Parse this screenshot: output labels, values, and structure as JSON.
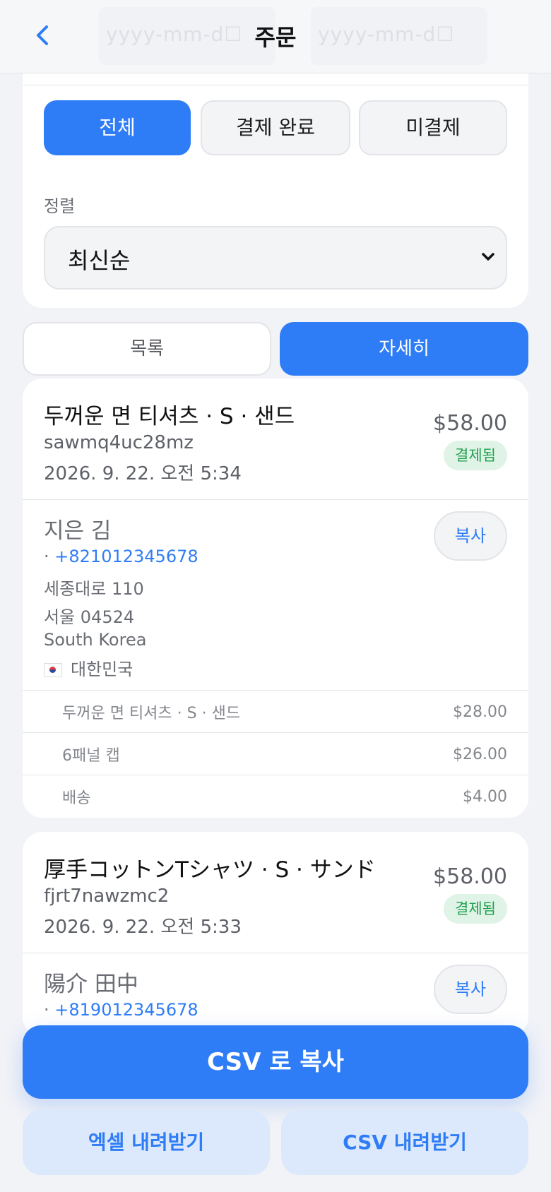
{
  "header": {
    "title": "주문",
    "back_icon": "chevron-left-icon",
    "date_placeholder_from": "yyyy-mm-d☐",
    "date_placeholder_to": "yyyy-mm-d☐"
  },
  "filters": {
    "segments": [
      "전체",
      "결제 완료",
      "미결제"
    ],
    "active_segment": "전체",
    "sort_label": "정렬",
    "sort_value": "최신순"
  },
  "view_toggle": {
    "list": "목록",
    "detail": "자세히",
    "active": "자세히"
  },
  "orders": [
    {
      "title": "두꺼운 면 티셔츠 · S · 샌드",
      "id": "sawmq4uc28mz",
      "date": "2026. 9. 22. 오전 5:34",
      "price": "$58.00",
      "status": "결제됨",
      "customer": {
        "name": "지은 김",
        "phone_prefix": "·",
        "phone": "+821012345678",
        "address1": "세종대로 110",
        "address2": "서울 04524",
        "country_en": "South Korea",
        "country_local": "대한민국"
      },
      "copy_label": "복사",
      "items": [
        {
          "name": "두꺼운 면 티셔츠 · S · 샌드",
          "price": "$28.00"
        },
        {
          "name": "6패널 캡",
          "price": "$26.00"
        },
        {
          "name": "배송",
          "price": "$4.00"
        }
      ]
    },
    {
      "title": "厚手コットンTシャツ · S · サンド",
      "id": "fjrt7nawzmc2",
      "date": "2026. 9. 22. 오전 5:33",
      "price": "$58.00",
      "status": "결제됨",
      "customer": {
        "name": "陽介 田中",
        "phone_prefix": "·",
        "phone": "+819012345678"
      },
      "copy_label": "복사"
    }
  ],
  "actions": {
    "csv_copy": "CSV 로 복사",
    "excel_download": "엑셀 내려받기",
    "csv_download": "CSV 내려받기"
  },
  "colors": {
    "accent": "#2f7df6",
    "paid_badge_bg": "#dff3e6",
    "paid_badge_text": "#21a04f",
    "background": "#f2f3f7"
  }
}
